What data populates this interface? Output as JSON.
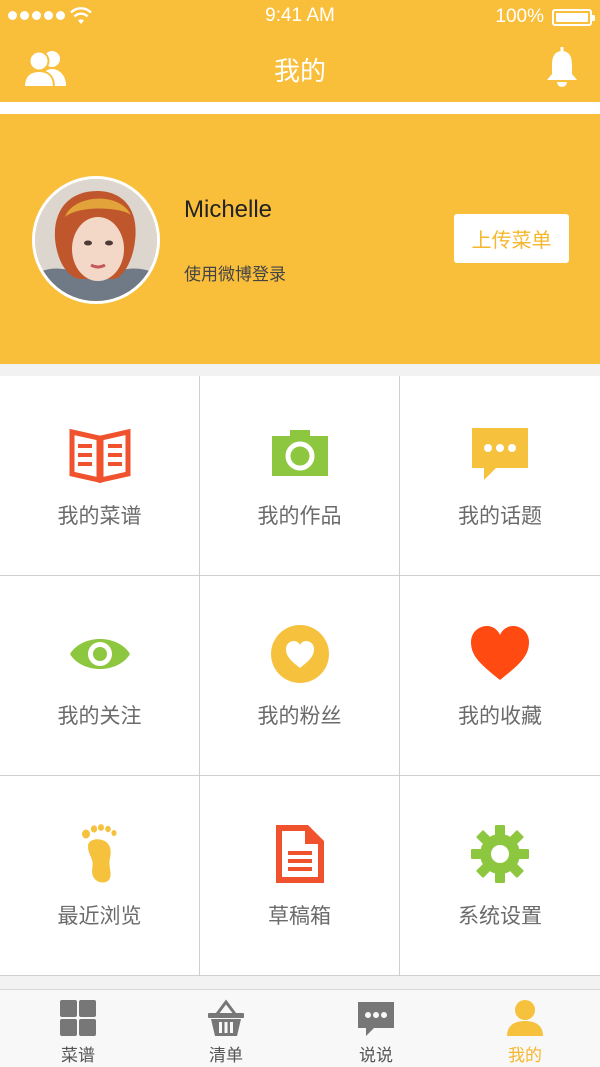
{
  "status_bar": {
    "time": "9:41 AM",
    "battery": "100%"
  },
  "nav": {
    "title": "我的",
    "left_icon": "friends-icon",
    "right_icon": "bell-icon"
  },
  "profile": {
    "username": "Michelle",
    "login_method": "使用微博登录",
    "upload_button": "上传菜单"
  },
  "grid": {
    "items": [
      {
        "label": "我的菜谱",
        "icon": "recipe-book-icon",
        "color": "#f0522d"
      },
      {
        "label": "我的作品",
        "icon": "camera-icon",
        "color": "#8dc63f"
      },
      {
        "label": "我的话题",
        "icon": "chat-bubble-icon",
        "color": "#f6c23e"
      },
      {
        "label": "我的关注",
        "icon": "eye-icon",
        "color": "#8dc63f"
      },
      {
        "label": "我的粉丝",
        "icon": "heart-circle-icon",
        "color": "#f6c23e"
      },
      {
        "label": "我的收藏",
        "icon": "heart-icon",
        "color": "#f0522d"
      },
      {
        "label": "最近浏览",
        "icon": "footprint-icon",
        "color": "#f6c23e"
      },
      {
        "label": "草稿箱",
        "icon": "draft-document-icon",
        "color": "#f0522d"
      },
      {
        "label": "系统设置",
        "icon": "gear-icon",
        "color": "#8dc63f"
      }
    ]
  },
  "tabbar": {
    "tabs": [
      {
        "label": "菜谱",
        "icon": "grid-tiles-icon"
      },
      {
        "label": "清单",
        "icon": "basket-icon"
      },
      {
        "label": "说说",
        "icon": "message-icon"
      },
      {
        "label": "我的",
        "icon": "user-icon",
        "active": true
      }
    ]
  },
  "colors": {
    "brand": "#f9bf3b",
    "accent_text": "#f6b72e",
    "grid_label": "#6b6b6b"
  }
}
